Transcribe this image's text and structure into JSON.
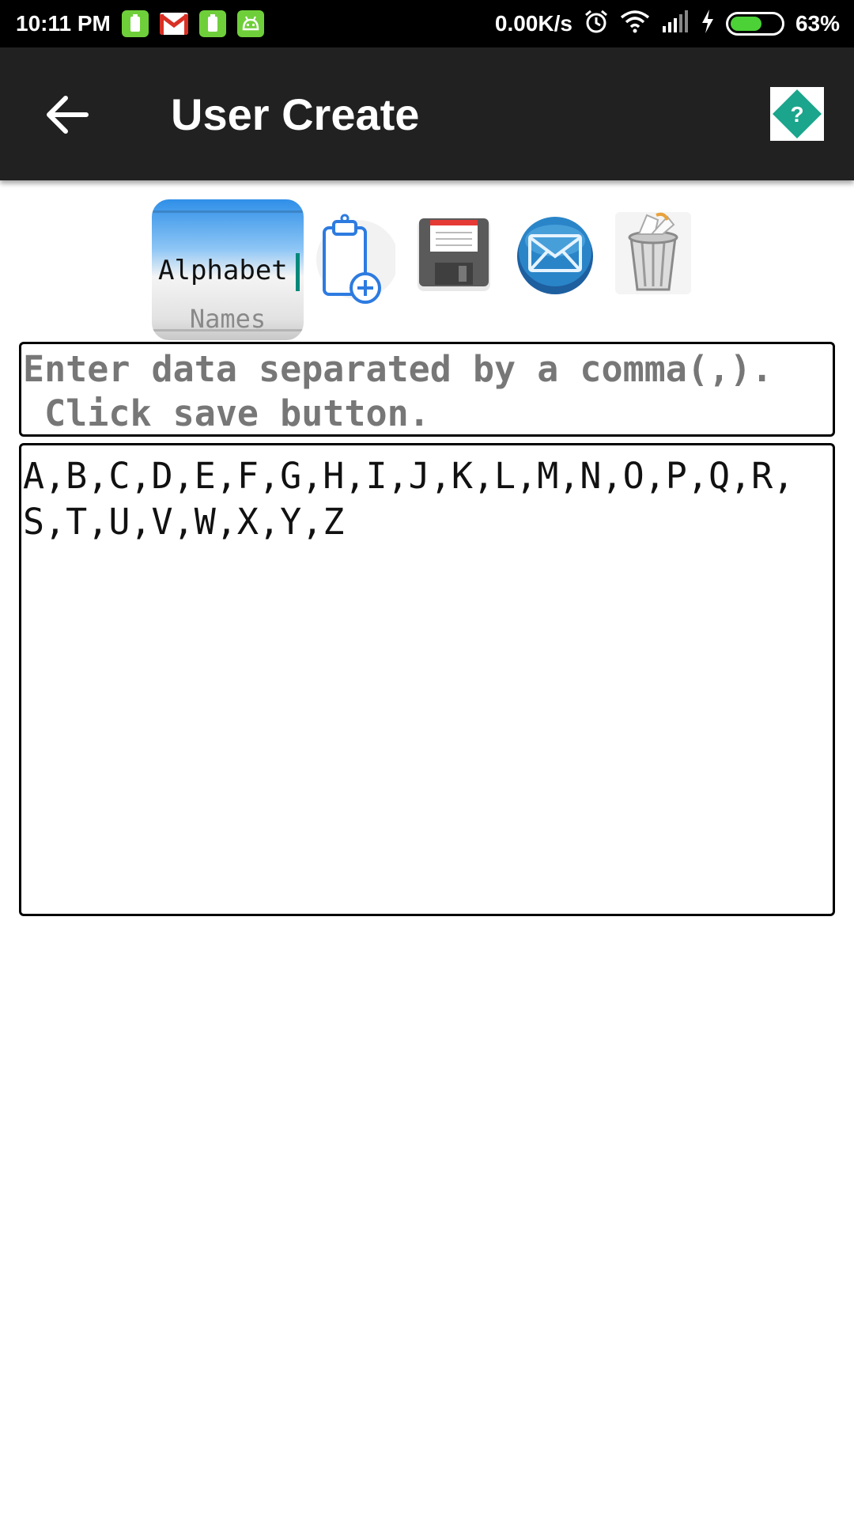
{
  "status_bar": {
    "time": "10:11 PM",
    "network_speed": "0.00K/s",
    "battery_percent": "63%",
    "battery_level": 0.63,
    "icons": [
      "battery-notification-icon",
      "gmail-icon",
      "battery-notification-icon",
      "android-icon",
      "alarm-icon",
      "wifi-icon",
      "signal-icon",
      "charging-icon",
      "battery-icon"
    ]
  },
  "app_bar": {
    "title": "User Create",
    "back_icon": "arrow-left-icon",
    "help_icon": "help-diamond-icon",
    "help_symbol": "?"
  },
  "toolbar": {
    "name_value": "Alphabet",
    "name_hint": "Names",
    "buttons": [
      "paste-clipboard-icon",
      "save-floppy-icon",
      "mail-icon",
      "trash-icon"
    ]
  },
  "hint": {
    "text": "Enter data separated by a comma(,).\n Click save button."
  },
  "data": {
    "text": "A,B,C,D,E,F,G,H,I,J,K,L,M,N,O,P,Q,R,S,T,U,V,W,X,Y,Z"
  },
  "colors": {
    "app_bar": "#212121",
    "status_bar": "#000000",
    "accent": "#00897b",
    "help": "#1aa58c"
  }
}
